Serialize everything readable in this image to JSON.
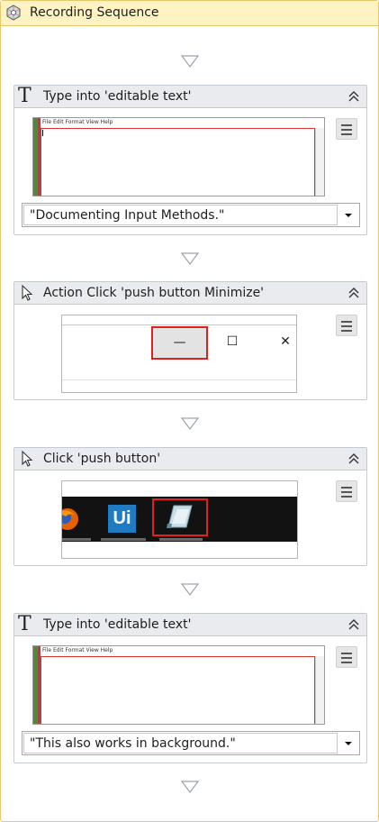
{
  "sequence": {
    "title": "Recording Sequence",
    "icon": "sequence-icon"
  },
  "activities": [
    {
      "title": "Type into 'editable text'",
      "icon": "type-into-icon",
      "glyph": "T",
      "text_value": "\"Documenting Input Methods.\"",
      "notepad_menu": "File   Edit   Format   View   Help"
    },
    {
      "title": "Action Click 'push button  Minimize'",
      "icon": "cursor-icon",
      "minimize_glyph": "—",
      "maximize_glyph": "☐",
      "close_glyph": "✕"
    },
    {
      "title": "Click 'push button'",
      "icon": "cursor-icon",
      "ui_logo": "Ui"
    },
    {
      "title": "Type into 'editable text'",
      "icon": "type-into-icon",
      "glyph": "T",
      "text_value": "\"This also works in background.\"",
      "notepad_menu": "File   Edit   Format   View   Help"
    }
  ],
  "colors": {
    "sequence_header": "#fff3c4",
    "sequence_border": "#e8c86a",
    "activity_header": "#e9ebee",
    "highlight": "#e02020"
  }
}
